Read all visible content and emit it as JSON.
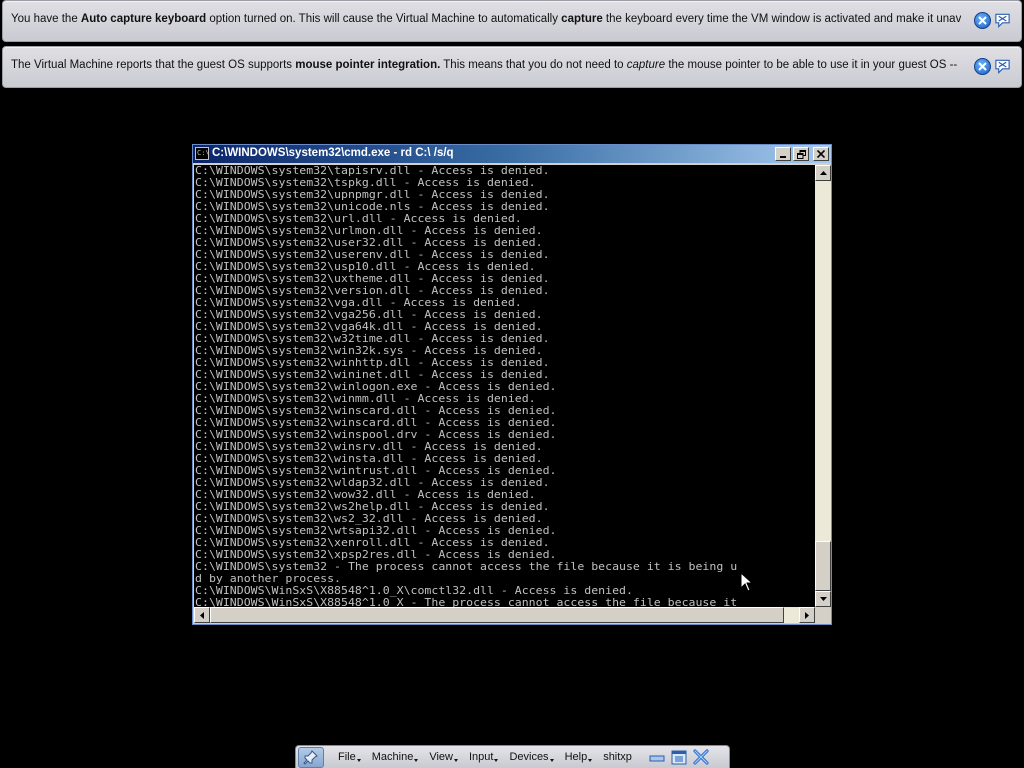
{
  "notices": [
    {
      "segments": [
        {
          "text": "You have the ",
          "style": "normal"
        },
        {
          "text": "Auto capture keyboard",
          "style": "bold"
        },
        {
          "text": " option turned on. This will cause the Virtual Machine to automatically ",
          "style": "normal"
        },
        {
          "text": "capture",
          "style": "bold"
        },
        {
          "text": " the keyboard every time the VM window is activated and make it unavailable to",
          "style": "normal"
        }
      ],
      "close_icon": "close-icon",
      "hide_icon": "speech-bubble-icon"
    },
    {
      "segments": [
        {
          "text": "The Virtual Machine reports that the guest OS supports ",
          "style": "normal"
        },
        {
          "text": "mouse pointer integration.",
          "style": "bold"
        },
        {
          "text": " This means that you do not need to ",
          "style": "normal"
        },
        {
          "text": "capture",
          "style": "italic"
        },
        {
          "text": " the mouse pointer to be able to use it in your guest OS -- all mouse",
          "style": "normal"
        }
      ],
      "close_icon": "close-icon",
      "hide_icon": "speech-bubble-icon"
    }
  ],
  "cmd": {
    "title": "C:\\WINDOWS\\system32\\cmd.exe - rd C:\\ /s/q",
    "icon_text": "C:\\",
    "lines": [
      "C:\\WINDOWS\\system32\\tapisrv.dll - Access is denied.",
      "C:\\WINDOWS\\system32\\tspkg.dll - Access is denied.",
      "C:\\WINDOWS\\system32\\upnpmgr.dll - Access is denied.",
      "C:\\WINDOWS\\system32\\unicode.nls - Access is denied.",
      "C:\\WINDOWS\\system32\\url.dll - Access is denied.",
      "C:\\WINDOWS\\system32\\urlmon.dll - Access is denied.",
      "C:\\WINDOWS\\system32\\user32.dll - Access is denied.",
      "C:\\WINDOWS\\system32\\userenv.dll - Access is denied.",
      "C:\\WINDOWS\\system32\\usp10.dll - Access is denied.",
      "C:\\WINDOWS\\system32\\uxtheme.dll - Access is denied.",
      "C:\\WINDOWS\\system32\\version.dll - Access is denied.",
      "C:\\WINDOWS\\system32\\vga.dll - Access is denied.",
      "C:\\WINDOWS\\system32\\vga256.dll - Access is denied.",
      "C:\\WINDOWS\\system32\\vga64k.dll - Access is denied.",
      "C:\\WINDOWS\\system32\\w32time.dll - Access is denied.",
      "C:\\WINDOWS\\system32\\win32k.sys - Access is denied.",
      "C:\\WINDOWS\\system32\\winhttp.dll - Access is denied.",
      "C:\\WINDOWS\\system32\\wininet.dll - Access is denied.",
      "C:\\WINDOWS\\system32\\winlogon.exe - Access is denied.",
      "C:\\WINDOWS\\system32\\winmm.dll - Access is denied.",
      "C:\\WINDOWS\\system32\\winscard.dll - Access is denied.",
      "C:\\WINDOWS\\system32\\winscard.dll - Access is denied.",
      "C:\\WINDOWS\\system32\\winspool.drv - Access is denied.",
      "C:\\WINDOWS\\system32\\winsrv.dll - Access is denied.",
      "C:\\WINDOWS\\system32\\winsta.dll - Access is denied.",
      "C:\\WINDOWS\\system32\\wintrust.dll - Access is denied.",
      "C:\\WINDOWS\\system32\\wldap32.dll - Access is denied.",
      "C:\\WINDOWS\\system32\\wow32.dll - Access is denied.",
      "C:\\WINDOWS\\system32\\ws2help.dll - Access is denied.",
      "C:\\WINDOWS\\system32\\ws2_32.dll - Access is denied.",
      "C:\\WINDOWS\\system32\\wtsapi32.dll - Access is denied.",
      "C:\\WINDOWS\\system32\\xenroll.dll - Access is denied.",
      "C:\\WINDOWS\\system32\\xpsp2res.dll - Access is denied.",
      "C:\\WINDOWS\\system32 - The process cannot access the file because it is being u",
      "d by another process.",
      "C:\\WINDOWS\\WinSxS\\X88548^1.0_X\\comctl32.dll - Access is denied.",
      "C:\\WINDOWS\\WinSxS\\X88548^1.0_X - The process cannot access the file because it"
    ]
  },
  "vm_toolbar": {
    "menus": [
      "File",
      "Machine",
      "View",
      "Input",
      "Devices",
      "Help"
    ],
    "vm_name": "shitxp",
    "pin_icon": "pin-icon",
    "controls": [
      "minimize-icon",
      "restore-icon",
      "close-icon"
    ]
  }
}
